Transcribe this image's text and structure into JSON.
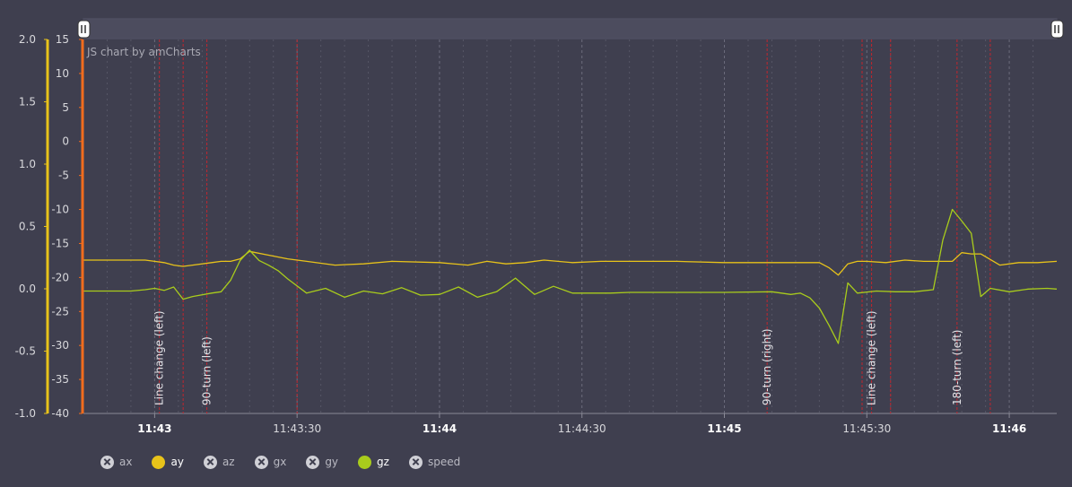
{
  "chart_data": {
    "type": "line",
    "credit": "JS chart by amCharts",
    "x_range": [
      "11:42:45",
      "11:46:10"
    ],
    "x_ticks": [
      {
        "label": "11:43",
        "time": "11:43:00",
        "major": true
      },
      {
        "label": "11:43:30",
        "time": "11:43:30",
        "major": false
      },
      {
        "label": "11:44",
        "time": "11:44:00",
        "major": true
      },
      {
        "label": "11:44:30",
        "time": "11:44:30",
        "major": false
      },
      {
        "label": "11:45",
        "time": "11:45:00",
        "major": true
      },
      {
        "label": "11:45:30",
        "time": "11:45:30",
        "major": false
      },
      {
        "label": "11:46",
        "time": "11:46:00",
        "major": true
      }
    ],
    "axes": [
      {
        "id": "left",
        "ylim": [
          -1.0,
          2.0
        ],
        "ticks": [
          "2.0",
          "1.5",
          "1.0",
          "0.5",
          "0.0",
          "-0.5",
          "-1.0"
        ],
        "tick_values": [
          2.0,
          1.5,
          1.0,
          0.5,
          0.0,
          -0.5,
          -1.0
        ],
        "color": "#e8c31a"
      },
      {
        "id": "inner",
        "ylim": [
          -40,
          15
        ],
        "ticks": [
          "15",
          "10",
          "5",
          "0",
          "-5",
          "-10",
          "-15",
          "-20",
          "-25",
          "-30",
          "-35",
          "-40"
        ],
        "tick_values": [
          15,
          10,
          5,
          0,
          -5,
          -10,
          -15,
          -20,
          -25,
          -30,
          -35,
          -40
        ],
        "color": "#f26c1d"
      }
    ],
    "series": [
      {
        "name": "ay",
        "axis": "left",
        "color": "#e8c31a",
        "x": [
          "11:42:45",
          "11:42:50",
          "11:42:55",
          "11:42:58",
          "11:43:00",
          "11:43:02",
          "11:43:04",
          "11:43:06",
          "11:43:08",
          "11:43:12",
          "11:43:14",
          "11:43:16",
          "11:43:18",
          "11:43:20",
          "11:43:24",
          "11:43:28",
          "11:43:32",
          "11:43:38",
          "11:43:44",
          "11:43:50",
          "11:44:00",
          "11:44:06",
          "11:44:10",
          "11:44:14",
          "11:44:18",
          "11:44:22",
          "11:44:28",
          "11:44:34",
          "11:44:40",
          "11:44:50",
          "11:45:00",
          "11:45:10",
          "11:45:16",
          "11:45:20",
          "11:45:22",
          "11:45:24",
          "11:45:26",
          "11:45:28",
          "11:45:30",
          "11:45:34",
          "11:45:38",
          "11:45:42",
          "11:45:44",
          "11:45:46",
          "11:45:48",
          "11:45:50",
          "11:45:52",
          "11:45:54",
          "11:45:58",
          "11:46:02",
          "11:46:06",
          "11:46:10"
        ],
        "y": [
          0.23,
          0.23,
          0.23,
          0.23,
          0.22,
          0.21,
          0.19,
          0.18,
          0.19,
          0.21,
          0.22,
          0.22,
          0.24,
          0.3,
          0.27,
          0.24,
          0.22,
          0.19,
          0.2,
          0.22,
          0.21,
          0.19,
          0.22,
          0.2,
          0.21,
          0.23,
          0.21,
          0.22,
          0.22,
          0.22,
          0.21,
          0.21,
          0.21,
          0.21,
          0.17,
          0.11,
          0.2,
          0.22,
          0.22,
          0.21,
          0.23,
          0.22,
          0.22,
          0.22,
          0.22,
          0.29,
          0.28,
          0.28,
          0.19,
          0.21,
          0.21,
          0.22
        ]
      },
      {
        "name": "gz",
        "axis": "inner",
        "color": "#a9cc1c",
        "x": [
          "11:42:45",
          "11:42:50",
          "11:42:55",
          "11:42:58",
          "11:43:00",
          "11:43:02",
          "11:43:04",
          "11:43:06",
          "11:43:08",
          "11:43:12",
          "11:43:14",
          "11:43:16",
          "11:43:18",
          "11:43:20",
          "11:43:22",
          "11:43:24",
          "11:43:26",
          "11:43:28",
          "11:43:32",
          "11:43:36",
          "11:43:40",
          "11:43:44",
          "11:43:48",
          "11:43:52",
          "11:43:56",
          "11:44:00",
          "11:44:04",
          "11:44:08",
          "11:44:12",
          "11:44:16",
          "11:44:20",
          "11:44:24",
          "11:44:28",
          "11:44:32",
          "11:44:36",
          "11:44:40",
          "11:44:50",
          "11:45:00",
          "11:45:10",
          "11:45:14",
          "11:45:16",
          "11:45:18",
          "11:45:20",
          "11:45:22",
          "11:45:24",
          "11:45:26",
          "11:45:28",
          "11:45:32",
          "11:45:36",
          "11:45:40",
          "11:45:44",
          "11:45:46",
          "11:45:48",
          "11:45:50",
          "11:45:52",
          "11:45:54",
          "11:45:56",
          "11:46:00",
          "11:46:04",
          "11:46:08",
          "11:46:10"
        ],
        "y": [
          -22,
          -22,
          -22,
          -21.8,
          -21.6,
          -21.9,
          -21.4,
          -23.2,
          -22.8,
          -22.3,
          -22.1,
          -20.4,
          -17.5,
          -16.0,
          -17.5,
          -18.2,
          -19.0,
          -20.2,
          -22.3,
          -21.6,
          -22.9,
          -22.0,
          -22.4,
          -21.5,
          -22.6,
          -22.5,
          -21.4,
          -22.9,
          -22.1,
          -20.1,
          -22.5,
          -21.3,
          -22.3,
          -22.3,
          -22.3,
          -22.2,
          -22.2,
          -22.2,
          -22.1,
          -22.5,
          -22.3,
          -23.0,
          -24.5,
          -27.0,
          -29.7,
          -20.8,
          -22.3,
          -22.0,
          -22.1,
          -22.1,
          -21.8,
          -14.5,
          -10.0,
          -11.7,
          -13.5,
          -22.8,
          -21.6,
          -22.1,
          -21.7,
          -21.6,
          -21.7
        ]
      }
    ],
    "guides": [
      {
        "label": "Line change (left)",
        "from": "11:43:01",
        "to": "11:43:06"
      },
      {
        "label": "90-turn (left)",
        "from": "11:43:11",
        "to": "11:43:30"
      },
      {
        "label": "90-turn (right)",
        "from": "11:45:09",
        "to": "11:45:29"
      },
      {
        "label": "Line change (left)",
        "from": "11:45:31",
        "to": "11:45:35"
      },
      {
        "label": "180-turn (left)",
        "from": "11:45:49",
        "to": "11:45:56"
      }
    ],
    "legend": {
      "placement": "bottom-left",
      "items": [
        {
          "label": "ax",
          "active": false,
          "color": "#d0d0d6"
        },
        {
          "label": "ay",
          "active": true,
          "color": "#e8c31a"
        },
        {
          "label": "az",
          "active": false,
          "color": "#d0d0d6"
        },
        {
          "label": "gx",
          "active": false,
          "color": "#d0d0d6"
        },
        {
          "label": "gy",
          "active": false,
          "color": "#d0d0d6"
        },
        {
          "label": "gz",
          "active": true,
          "color": "#a9cc1c"
        },
        {
          "label": "speed",
          "active": false,
          "color": "#d0d0d6"
        }
      ]
    },
    "grid": true,
    "scrollbar": true
  }
}
